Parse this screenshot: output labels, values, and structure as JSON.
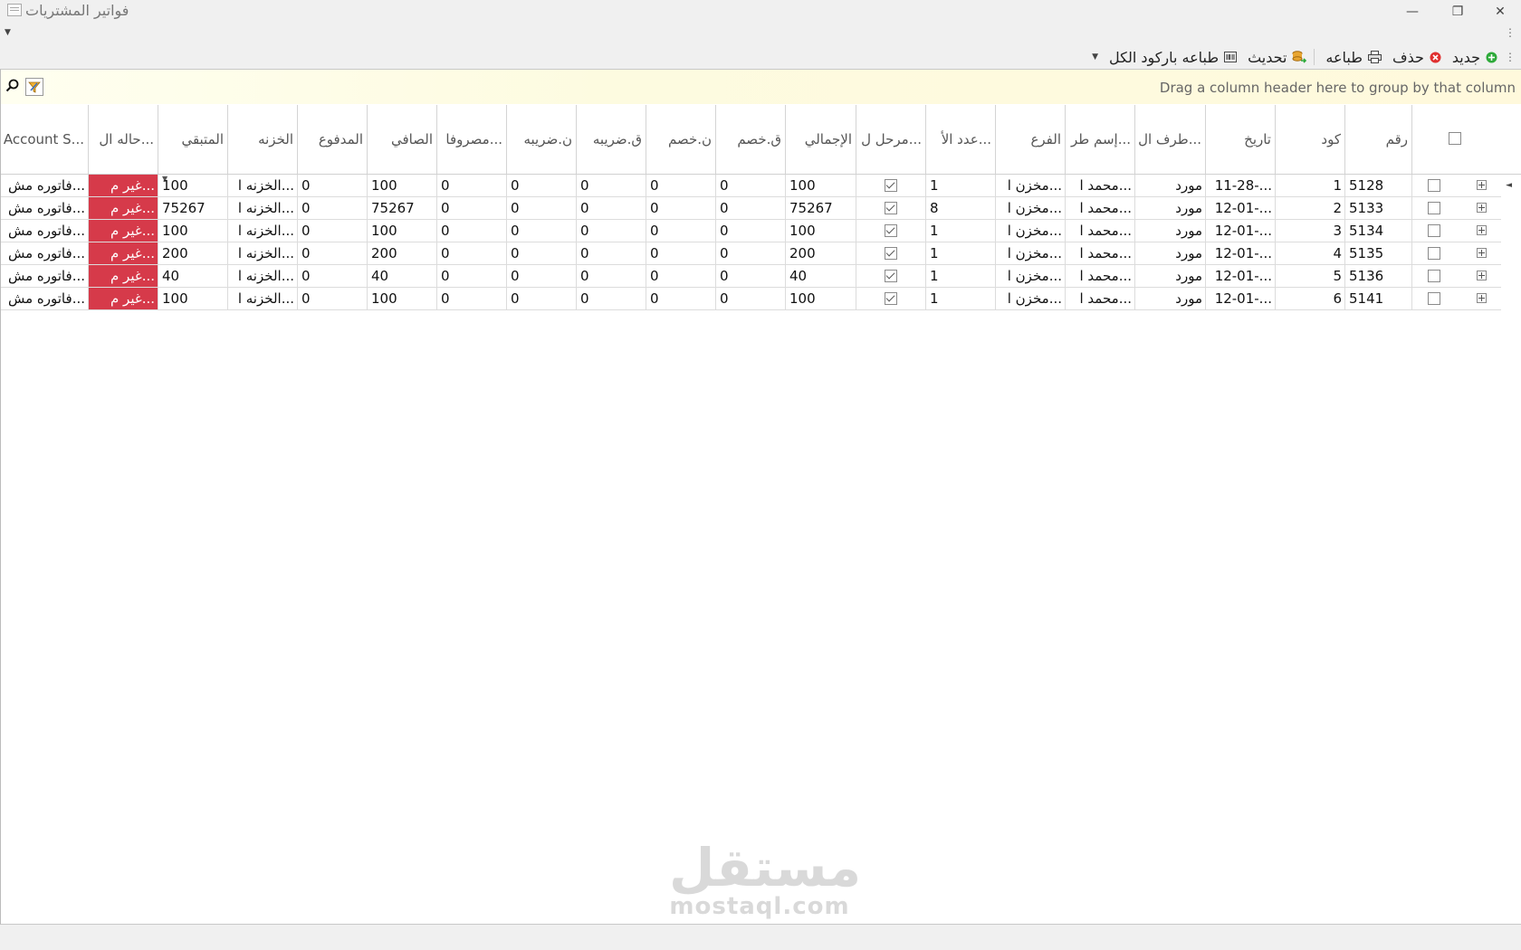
{
  "window": {
    "title": "فواتير المشتريات",
    "minimize": "—",
    "restore": "❐",
    "close": "✕"
  },
  "toolbar": {
    "new_label": "جديد",
    "delete_label": "حذف",
    "print_label": "طباعه",
    "refresh_label": "تحديث",
    "print_barcode_label": "طباعه باركود الكل"
  },
  "grid": {
    "group_hint": "Drag a column header here to group by that column",
    "columns": [
      "رقم",
      "كود",
      "تاريخ",
      "طرف ال...",
      "إسم طر...",
      "الفرع",
      "عدد الأ...",
      "مرحل ل...",
      "الإجمالي",
      "ق.خصم",
      "ن.خصم",
      "ق.ضريبه",
      "ن.ضريبه",
      "مصروفا...",
      "الصافي",
      "المدفوع",
      "الخزنه",
      "المتبقي",
      "حاله ال...",
      "Account S..."
    ],
    "rows": [
      {
        "num": "5128",
        "code": "1",
        "date": "11-28-...",
        "party": "مورد",
        "party_name": "محمد ا...",
        "branch": "مخزن ا...",
        "count": "1",
        "posted": true,
        "total": "100",
        "disc_val": "0",
        "disc_pct": "0",
        "tax_val": "0",
        "tax_pct": "0",
        "expenses": "0",
        "net": "100",
        "paid": "0",
        "treasury": "الخزنه ا...",
        "remaining": "100",
        "status": "غير م...",
        "account": "فاتوره مش..."
      },
      {
        "num": "5133",
        "code": "2",
        "date": "12-01-...",
        "party": "مورد",
        "party_name": "محمد ا...",
        "branch": "مخزن ا...",
        "count": "8",
        "posted": true,
        "total": "75267",
        "disc_val": "0",
        "disc_pct": "0",
        "tax_val": "0",
        "tax_pct": "0",
        "expenses": "0",
        "net": "75267",
        "paid": "0",
        "treasury": "الخزنه ا...",
        "remaining": "75267",
        "status": "غير م...",
        "account": "فاتوره مش..."
      },
      {
        "num": "5134",
        "code": "3",
        "date": "12-01-...",
        "party": "مورد",
        "party_name": "محمد ا...",
        "branch": "مخزن ا...",
        "count": "1",
        "posted": true,
        "total": "100",
        "disc_val": "0",
        "disc_pct": "0",
        "tax_val": "0",
        "tax_pct": "0",
        "expenses": "0",
        "net": "100",
        "paid": "0",
        "treasury": "الخزنه ا...",
        "remaining": "100",
        "status": "غير م...",
        "account": "فاتوره مش..."
      },
      {
        "num": "5135",
        "code": "4",
        "date": "12-01-...",
        "party": "مورد",
        "party_name": "محمد ا...",
        "branch": "مخزن ا...",
        "count": "1",
        "posted": true,
        "total": "200",
        "disc_val": "0",
        "disc_pct": "0",
        "tax_val": "0",
        "tax_pct": "0",
        "expenses": "0",
        "net": "200",
        "paid": "0",
        "treasury": "الخزنه ا...",
        "remaining": "200",
        "status": "غير م...",
        "account": "فاتوره مش..."
      },
      {
        "num": "5136",
        "code": "5",
        "date": "12-01-...",
        "party": "مورد",
        "party_name": "محمد ا...",
        "branch": "مخزن ا...",
        "count": "1",
        "posted": true,
        "total": "40",
        "disc_val": "0",
        "disc_pct": "0",
        "tax_val": "0",
        "tax_pct": "0",
        "expenses": "0",
        "net": "40",
        "paid": "0",
        "treasury": "الخزنه ا...",
        "remaining": "40",
        "status": "غير م...",
        "account": "فاتوره مش..."
      },
      {
        "num": "5141",
        "code": "6",
        "date": "12-01-...",
        "party": "مورد",
        "party_name": "محمد ا...",
        "branch": "مخزن ا...",
        "count": "1",
        "posted": true,
        "total": "100",
        "disc_val": "0",
        "disc_pct": "0",
        "tax_val": "0",
        "tax_pct": "0",
        "expenses": "0",
        "net": "100",
        "paid": "0",
        "treasury": "الخزنه ا...",
        "remaining": "100",
        "status": "غير م...",
        "account": "فاتوره مش..."
      }
    ]
  },
  "watermark": {
    "arabic": "مستقل",
    "latin": "mostaql.com"
  },
  "colors": {
    "status_red": "#d63a4a",
    "group_bar": "#fdfbe0",
    "add_green": "#2eaa3a",
    "delete_red": "#e03030"
  },
  "icons": [
    "title-window-icon",
    "add-icon",
    "delete-icon",
    "print-icon",
    "refresh-icon",
    "barcode-icon",
    "search-icon",
    "filter-icon",
    "expand-icon",
    "checkbox-icon"
  ]
}
